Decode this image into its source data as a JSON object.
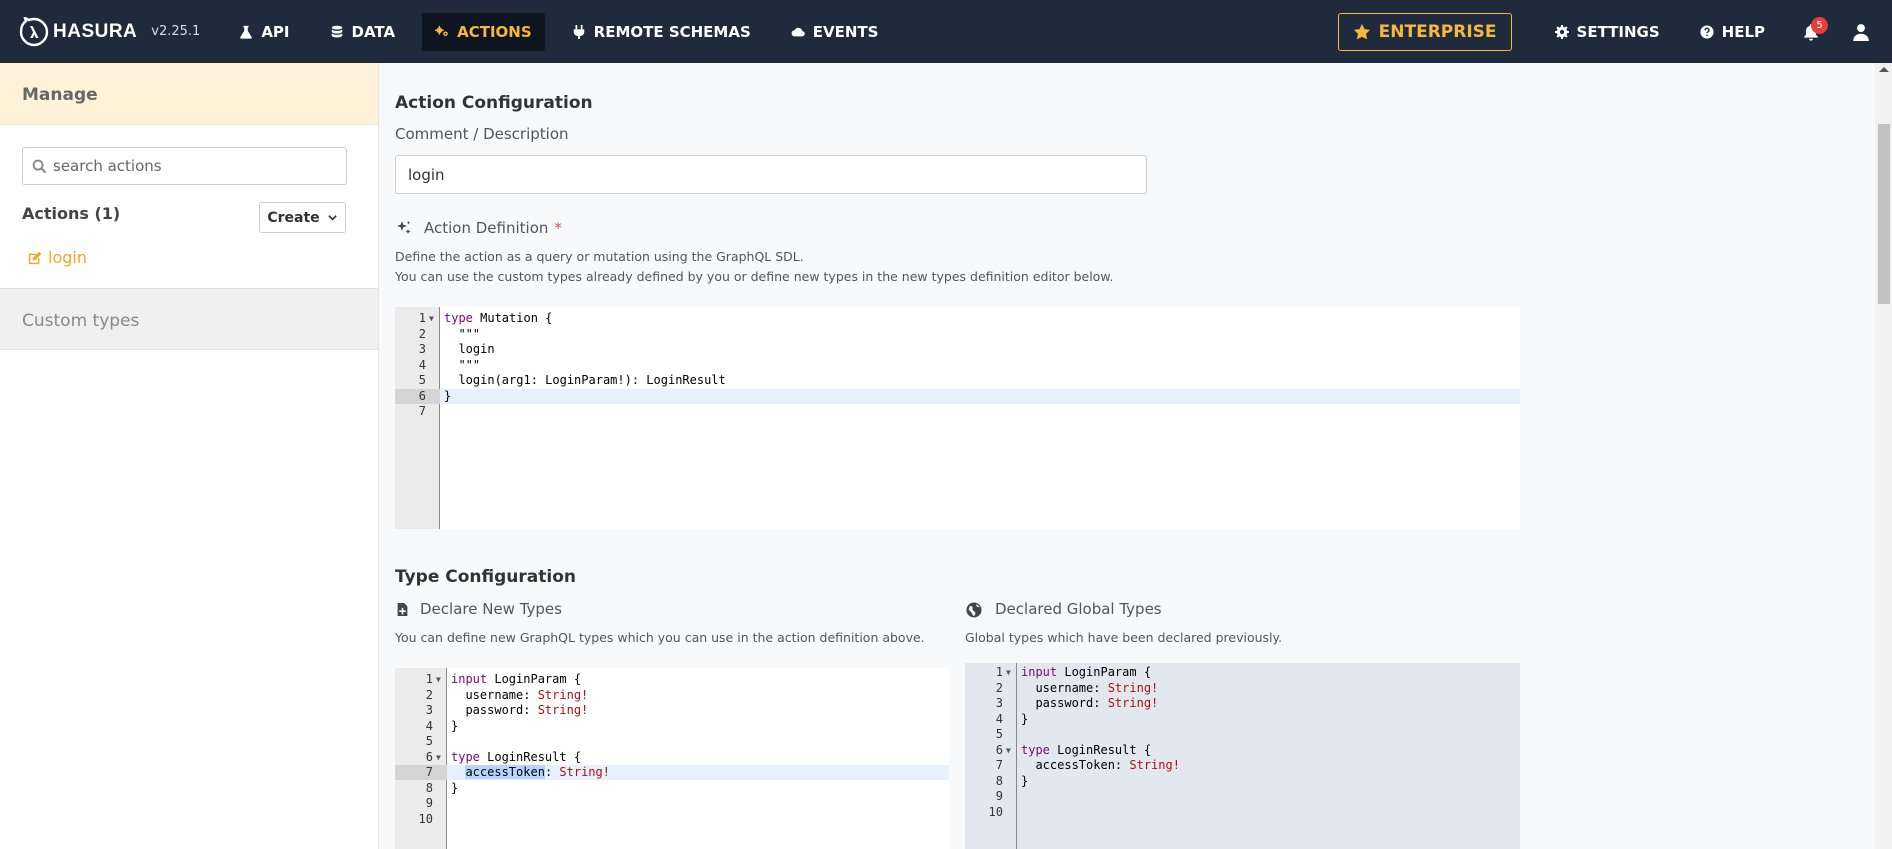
{
  "nav": {
    "logo": "HASURA",
    "version": "v2.25.1",
    "items": [
      {
        "label": "API",
        "icon": "flask-icon"
      },
      {
        "label": "DATA",
        "icon": "database-icon"
      },
      {
        "label": "ACTIONS",
        "icon": "cogs-icon",
        "active": true
      },
      {
        "label": "REMOTE SCHEMAS",
        "icon": "plug-icon"
      },
      {
        "label": "EVENTS",
        "icon": "cloud-icon"
      }
    ],
    "enterprise": "ENTERPRISE",
    "settings": "SETTINGS",
    "help": "HELP",
    "notifications": "5",
    "accent": "#f8b73b"
  },
  "sidebar": {
    "title": "Manage",
    "search_placeholder": "search actions",
    "actions_count": "Actions (1)",
    "create": "Create",
    "action_items": [
      "login"
    ],
    "custom_types": "Custom types"
  },
  "main": {
    "action_config_title": "Action Configuration",
    "comment_label": "Comment / Description",
    "comment_value": "login",
    "definition_label": "Action Definition",
    "required_mark": "*",
    "definition_help_1": "Define the action as a query or mutation using the GraphQL SDL.",
    "definition_help_2": "You can use the custom types already defined by you or define new types in the new types definition editor below.",
    "definition_code": [
      "type Mutation {",
      "  \"\"\"",
      "  login",
      "  \"\"\"",
      "  login(arg1: LoginParam!): LoginResult",
      "}",
      ""
    ],
    "type_config_title": "Type Configuration",
    "new_types_label": "Declare New Types",
    "new_types_help": "You can define new GraphQL types which you can use in the action definition above.",
    "new_types_code": [
      "input LoginParam {",
      "  username: String!",
      "  password: String!",
      "}",
      "",
      "type LoginResult {",
      "  accessToken: String!",
      "}",
      "",
      ""
    ],
    "global_types_label": "Declared Global Types",
    "global_types_help": "Global types which have been declared previously.",
    "global_types_code": [
      "input LoginParam {",
      "  username: String!",
      "  password: String!",
      "}",
      "",
      "type LoginResult {",
      "  accessToken: String!",
      "}",
      "",
      ""
    ]
  }
}
